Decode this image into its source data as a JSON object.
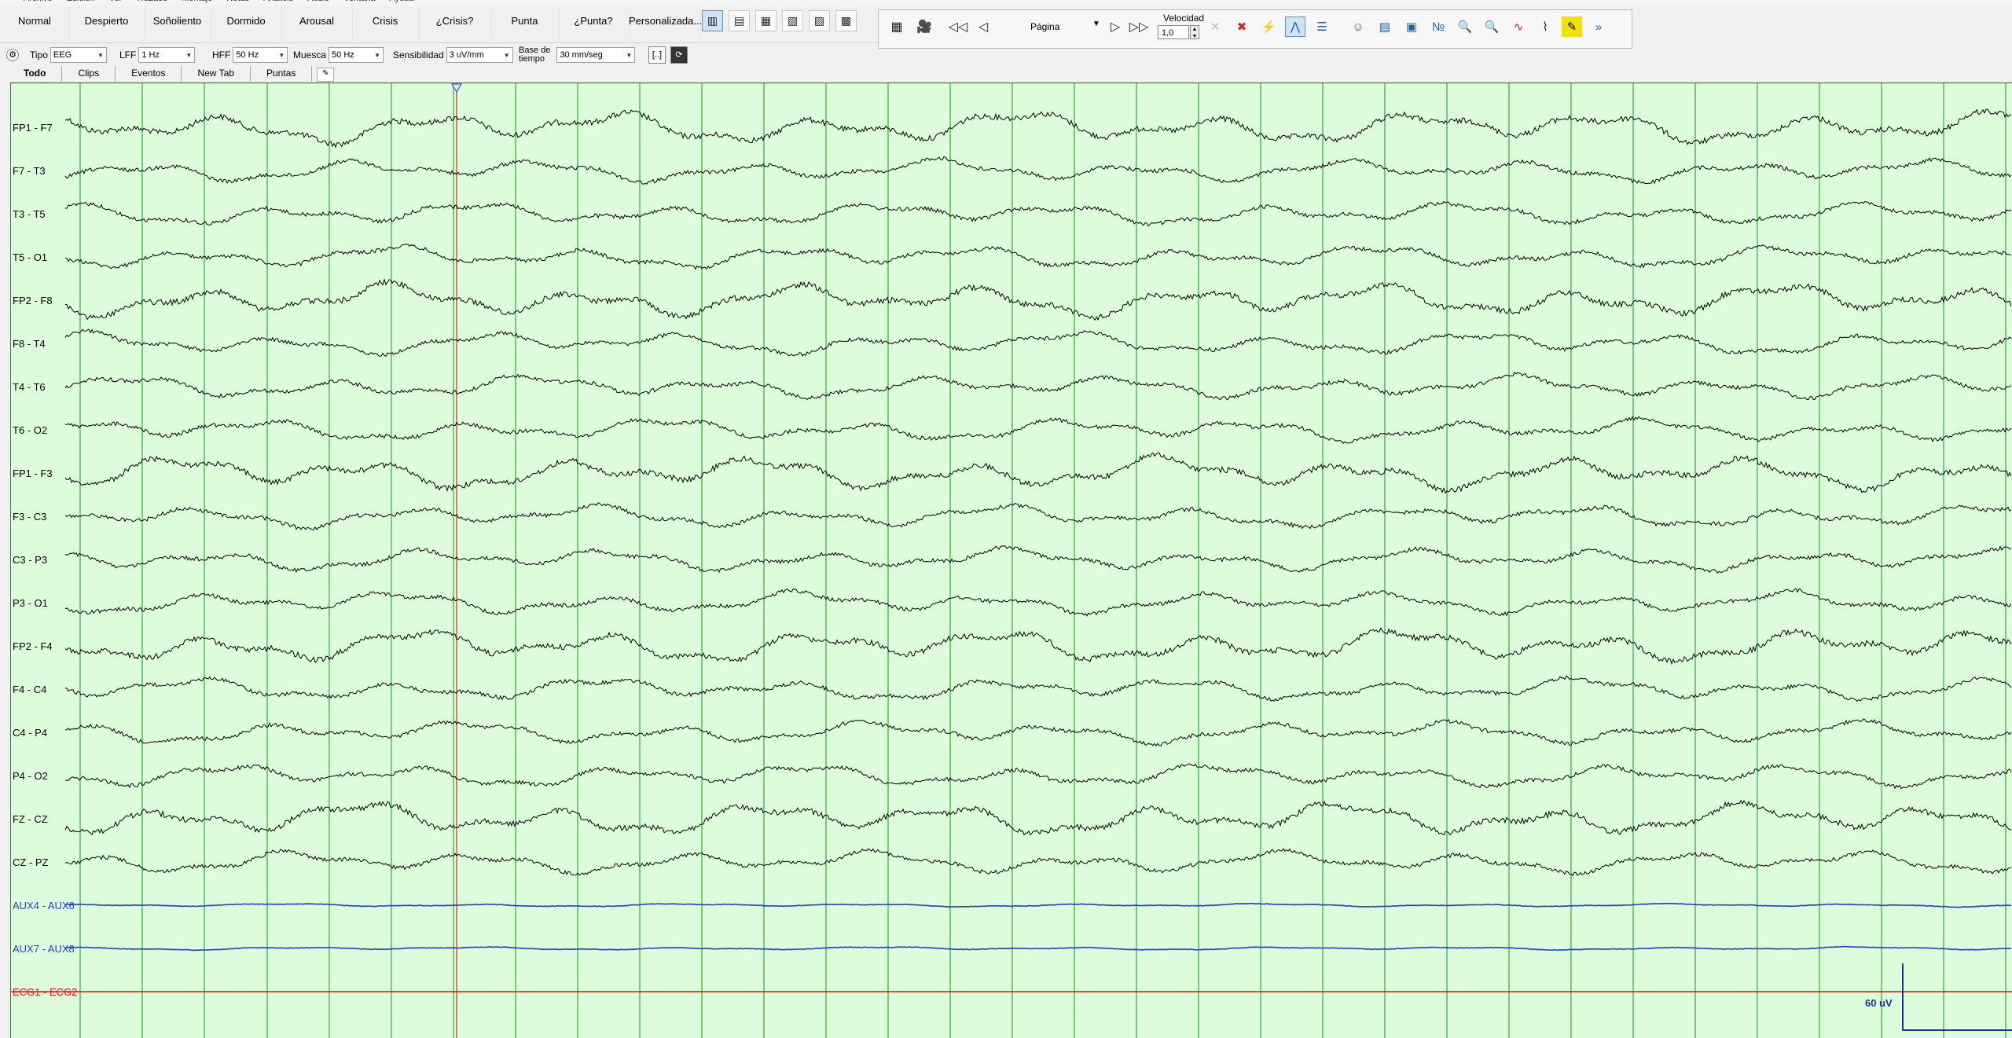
{
  "menu": [
    "Archivo",
    "Edición",
    "Ver",
    "Trazado",
    "Montaje",
    "Notas",
    "Análisis",
    "Audio",
    "Ventana",
    "Ayuda"
  ],
  "event_buttons": [
    "Normal",
    "Despierto",
    "Soñoliento",
    "Dormido",
    "Arousal",
    "Crisis",
    "¿Crisis?",
    "Punta",
    "¿Punta?",
    "Personalizada..."
  ],
  "view_icons": [
    "layout-1-icon",
    "layout-2-icon",
    "layout-3-icon",
    "layout-4-icon",
    "layout-5-icon",
    "layout-6-icon"
  ],
  "navigation": {
    "page_label": "Página",
    "speed_label": "Velocidad",
    "speed_value": "1,0"
  },
  "settings": {
    "tipo_label": "Tipo",
    "tipo_value": "EEG",
    "lff_label": "LFF",
    "lff_value": "1 Hz",
    "hff_label": "HFF",
    "hff_value": "50 Hz",
    "muesca_label": "Muesca",
    "muesca_value": "50 Hz",
    "sens_label": "Sensibilidad",
    "sens_value": "3 uV/mm",
    "base_label_1": "Base de",
    "base_label_2": "tiempo",
    "base_value": "30 mm/seg"
  },
  "tabs": [
    "Todo",
    "Clips",
    "Eventos",
    "New Tab",
    "Puntas"
  ],
  "channels": [
    {
      "label": "FP1 - F7",
      "color": "#000000"
    },
    {
      "label": "F7 - T3",
      "color": "#000000"
    },
    {
      "label": "T3 - T5",
      "color": "#000000"
    },
    {
      "label": "T5 - O1",
      "color": "#000000"
    },
    {
      "label": "FP2 - F8",
      "color": "#000000"
    },
    {
      "label": "F8 - T4",
      "color": "#000000"
    },
    {
      "label": "T4 - T6",
      "color": "#000000"
    },
    {
      "label": "T6 - O2",
      "color": "#000000"
    },
    {
      "label": "FP1 - F3",
      "color": "#000000"
    },
    {
      "label": "F3 - C3",
      "color": "#000000"
    },
    {
      "label": "C3 - P3",
      "color": "#000000"
    },
    {
      "label": "P3 - O1",
      "color": "#000000"
    },
    {
      "label": "FP2 - F4",
      "color": "#000000"
    },
    {
      "label": "F4 - C4",
      "color": "#000000"
    },
    {
      "label": "C4 - P4",
      "color": "#000000"
    },
    {
      "label": "P4 - O2",
      "color": "#000000"
    },
    {
      "label": "FZ - CZ",
      "color": "#000000"
    },
    {
      "label": "CZ - PZ",
      "color": "#000000"
    },
    {
      "label": "AUX4 - AUX6",
      "color": "#1f3fd0"
    },
    {
      "label": "AUX7 - AUX8",
      "color": "#1f3fd0"
    },
    {
      "label": "ECG1 - ECG2",
      "color": "#e01010"
    }
  ],
  "calibration_label": "60 uV",
  "colors": {
    "background": "#dcfcdc",
    "gridline": "#3aa83a",
    "cursor": "#e03030",
    "topline": "#2b3fb6"
  }
}
